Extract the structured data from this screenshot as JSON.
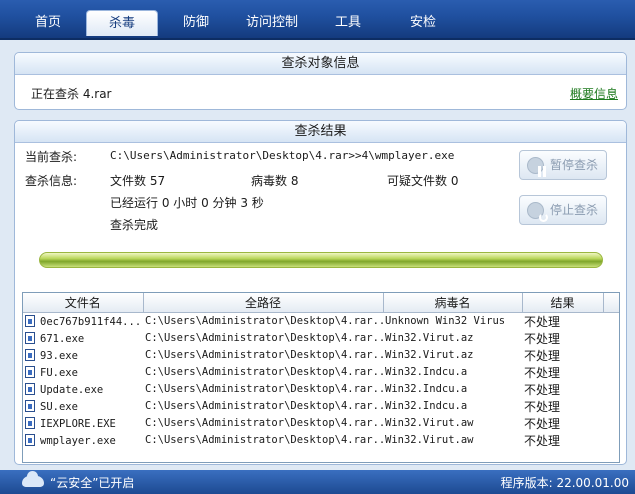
{
  "nav": {
    "tabs": [
      {
        "label": "首页"
      },
      {
        "label": "杀毒"
      },
      {
        "label": "防御"
      },
      {
        "label": "访问控制"
      },
      {
        "label": "工具"
      },
      {
        "label": "安检"
      }
    ]
  },
  "scan_target": {
    "header": "查杀对象信息",
    "status": "正在查杀 4.rar",
    "summary_link": "概要信息"
  },
  "scan_result": {
    "header": "查杀结果",
    "current_label": "当前查杀:",
    "current_path": "C:\\Users\\Administrator\\Desktop\\4.rar>>4\\wmplayer.exe",
    "info_label": "查杀信息:",
    "file_count": "文件数 57",
    "virus_count": "病毒数 8",
    "suspicious_count": "可疑文件数 0",
    "elapsed": "已经运行 0 小时 0 分钟 3  秒",
    "done": "查杀完成",
    "pause_button": "暂停查杀",
    "stop_button": "停止查杀",
    "progress": 1.0
  },
  "table": {
    "columns": [
      "文件名",
      "全路径",
      "病毒名",
      "结果"
    ],
    "rows": [
      {
        "name": "0ec767b911f44...",
        "path": "C:\\Users\\Administrator\\Desktop\\4.rar...",
        "virus": "Unknown Win32 Virus",
        "result": "不处理"
      },
      {
        "name": "671.exe",
        "path": "C:\\Users\\Administrator\\Desktop\\4.rar...",
        "virus": "Win32.Virut.az",
        "result": "不处理"
      },
      {
        "name": "93.exe",
        "path": "C:\\Users\\Administrator\\Desktop\\4.rar...",
        "virus": "Win32.Virut.az",
        "result": "不处理"
      },
      {
        "name": "FU.exe",
        "path": "C:\\Users\\Administrator\\Desktop\\4.rar...",
        "virus": "Win32.Indcu.a",
        "result": "不处理"
      },
      {
        "name": "Update.exe",
        "path": "C:\\Users\\Administrator\\Desktop\\4.rar...",
        "virus": "Win32.Indcu.a",
        "result": "不处理"
      },
      {
        "name": "SU.exe",
        "path": "C:\\Users\\Administrator\\Desktop\\4.rar...",
        "virus": "Win32.Indcu.a",
        "result": "不处理"
      },
      {
        "name": "IEXPLORE.EXE",
        "path": "C:\\Users\\Administrator\\Desktop\\4.rar...",
        "virus": "Win32.Virut.aw",
        "result": "不处理"
      },
      {
        "name": "wmplayer.exe",
        "path": "C:\\Users\\Administrator\\Desktop\\4.rar...",
        "virus": "Win32.Virut.aw",
        "result": "不处理"
      }
    ]
  },
  "statusbar": {
    "cloud_text": "“云安全”已开启",
    "version": "程序版本: 22.00.01.00"
  }
}
